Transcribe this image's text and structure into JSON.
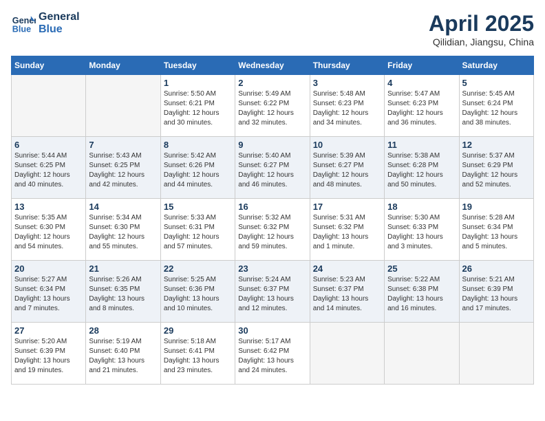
{
  "header": {
    "logo_line1": "General",
    "logo_line2": "Blue",
    "month_title": "April 2025",
    "location": "Qilidian, Jiangsu, China"
  },
  "days_of_week": [
    "Sunday",
    "Monday",
    "Tuesday",
    "Wednesday",
    "Thursday",
    "Friday",
    "Saturday"
  ],
  "weeks": [
    [
      {
        "day": "",
        "info": ""
      },
      {
        "day": "",
        "info": ""
      },
      {
        "day": "1",
        "info": "Sunrise: 5:50 AM\nSunset: 6:21 PM\nDaylight: 12 hours\nand 30 minutes."
      },
      {
        "day": "2",
        "info": "Sunrise: 5:49 AM\nSunset: 6:22 PM\nDaylight: 12 hours\nand 32 minutes."
      },
      {
        "day": "3",
        "info": "Sunrise: 5:48 AM\nSunset: 6:23 PM\nDaylight: 12 hours\nand 34 minutes."
      },
      {
        "day": "4",
        "info": "Sunrise: 5:47 AM\nSunset: 6:23 PM\nDaylight: 12 hours\nand 36 minutes."
      },
      {
        "day": "5",
        "info": "Sunrise: 5:45 AM\nSunset: 6:24 PM\nDaylight: 12 hours\nand 38 minutes."
      }
    ],
    [
      {
        "day": "6",
        "info": "Sunrise: 5:44 AM\nSunset: 6:25 PM\nDaylight: 12 hours\nand 40 minutes."
      },
      {
        "day": "7",
        "info": "Sunrise: 5:43 AM\nSunset: 6:25 PM\nDaylight: 12 hours\nand 42 minutes."
      },
      {
        "day": "8",
        "info": "Sunrise: 5:42 AM\nSunset: 6:26 PM\nDaylight: 12 hours\nand 44 minutes."
      },
      {
        "day": "9",
        "info": "Sunrise: 5:40 AM\nSunset: 6:27 PM\nDaylight: 12 hours\nand 46 minutes."
      },
      {
        "day": "10",
        "info": "Sunrise: 5:39 AM\nSunset: 6:27 PM\nDaylight: 12 hours\nand 48 minutes."
      },
      {
        "day": "11",
        "info": "Sunrise: 5:38 AM\nSunset: 6:28 PM\nDaylight: 12 hours\nand 50 minutes."
      },
      {
        "day": "12",
        "info": "Sunrise: 5:37 AM\nSunset: 6:29 PM\nDaylight: 12 hours\nand 52 minutes."
      }
    ],
    [
      {
        "day": "13",
        "info": "Sunrise: 5:35 AM\nSunset: 6:30 PM\nDaylight: 12 hours\nand 54 minutes."
      },
      {
        "day": "14",
        "info": "Sunrise: 5:34 AM\nSunset: 6:30 PM\nDaylight: 12 hours\nand 55 minutes."
      },
      {
        "day": "15",
        "info": "Sunrise: 5:33 AM\nSunset: 6:31 PM\nDaylight: 12 hours\nand 57 minutes."
      },
      {
        "day": "16",
        "info": "Sunrise: 5:32 AM\nSunset: 6:32 PM\nDaylight: 12 hours\nand 59 minutes."
      },
      {
        "day": "17",
        "info": "Sunrise: 5:31 AM\nSunset: 6:32 PM\nDaylight: 13 hours\nand 1 minute."
      },
      {
        "day": "18",
        "info": "Sunrise: 5:30 AM\nSunset: 6:33 PM\nDaylight: 13 hours\nand 3 minutes."
      },
      {
        "day": "19",
        "info": "Sunrise: 5:28 AM\nSunset: 6:34 PM\nDaylight: 13 hours\nand 5 minutes."
      }
    ],
    [
      {
        "day": "20",
        "info": "Sunrise: 5:27 AM\nSunset: 6:34 PM\nDaylight: 13 hours\nand 7 minutes."
      },
      {
        "day": "21",
        "info": "Sunrise: 5:26 AM\nSunset: 6:35 PM\nDaylight: 13 hours\nand 8 minutes."
      },
      {
        "day": "22",
        "info": "Sunrise: 5:25 AM\nSunset: 6:36 PM\nDaylight: 13 hours\nand 10 minutes."
      },
      {
        "day": "23",
        "info": "Sunrise: 5:24 AM\nSunset: 6:37 PM\nDaylight: 13 hours\nand 12 minutes."
      },
      {
        "day": "24",
        "info": "Sunrise: 5:23 AM\nSunset: 6:37 PM\nDaylight: 13 hours\nand 14 minutes."
      },
      {
        "day": "25",
        "info": "Sunrise: 5:22 AM\nSunset: 6:38 PM\nDaylight: 13 hours\nand 16 minutes."
      },
      {
        "day": "26",
        "info": "Sunrise: 5:21 AM\nSunset: 6:39 PM\nDaylight: 13 hours\nand 17 minutes."
      }
    ],
    [
      {
        "day": "27",
        "info": "Sunrise: 5:20 AM\nSunset: 6:39 PM\nDaylight: 13 hours\nand 19 minutes."
      },
      {
        "day": "28",
        "info": "Sunrise: 5:19 AM\nSunset: 6:40 PM\nDaylight: 13 hours\nand 21 minutes."
      },
      {
        "day": "29",
        "info": "Sunrise: 5:18 AM\nSunset: 6:41 PM\nDaylight: 13 hours\nand 23 minutes."
      },
      {
        "day": "30",
        "info": "Sunrise: 5:17 AM\nSunset: 6:42 PM\nDaylight: 13 hours\nand 24 minutes."
      },
      {
        "day": "",
        "info": ""
      },
      {
        "day": "",
        "info": ""
      },
      {
        "day": "",
        "info": ""
      }
    ]
  ]
}
